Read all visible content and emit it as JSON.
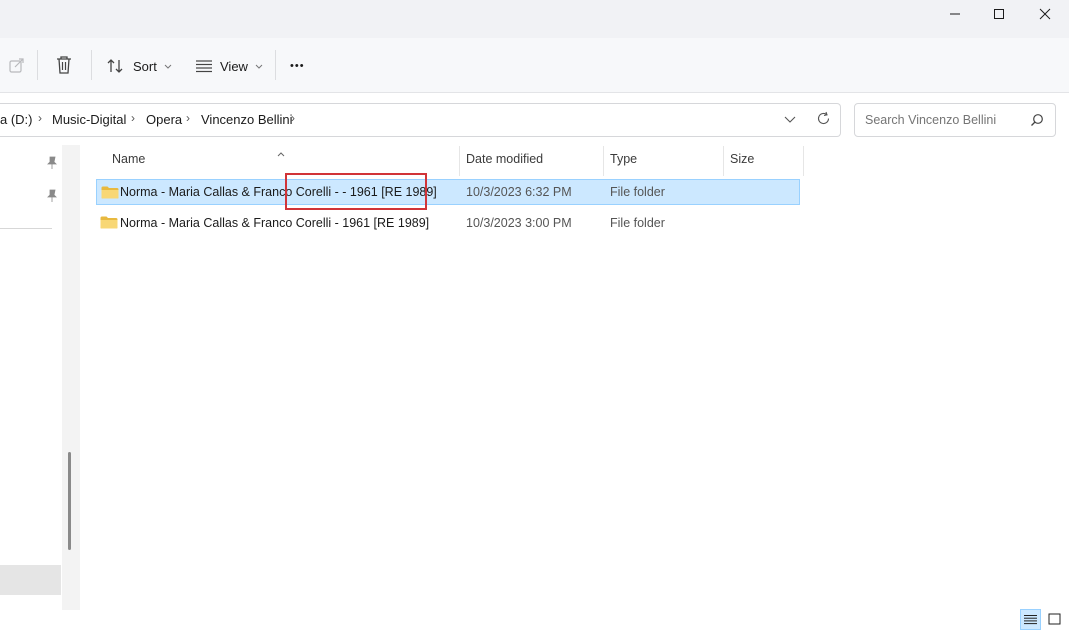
{
  "toolbar": {
    "sort_label": "Sort",
    "view_label": "View",
    "more_label": "•••"
  },
  "address": {
    "crumbs": [
      "a (D:)",
      "Music-Digital",
      "Opera",
      "Vincenzo Bellini"
    ]
  },
  "search": {
    "placeholder": "Search Vincenzo Bellini"
  },
  "columns": {
    "name": "Name",
    "date_modified": "Date modified",
    "type": "Type",
    "size": "Size"
  },
  "files": [
    {
      "name": "Norma - Maria Callas & Franco Corelli -  - 1961 [RE 1989]",
      "date_modified": "10/3/2023 6:32 PM",
      "type": "File folder",
      "size": "",
      "selected": true
    },
    {
      "name": "Norma - Maria Callas & Franco Corelli - 1961 [RE 1989]",
      "date_modified": "10/3/2023 3:00 PM",
      "type": "File folder",
      "size": "",
      "selected": false
    }
  ],
  "colors": {
    "selection_bg": "#cce8ff",
    "selection_border": "#99d1ff",
    "highlight_box": "#d13438",
    "folder_yellow": "#f8d775"
  }
}
